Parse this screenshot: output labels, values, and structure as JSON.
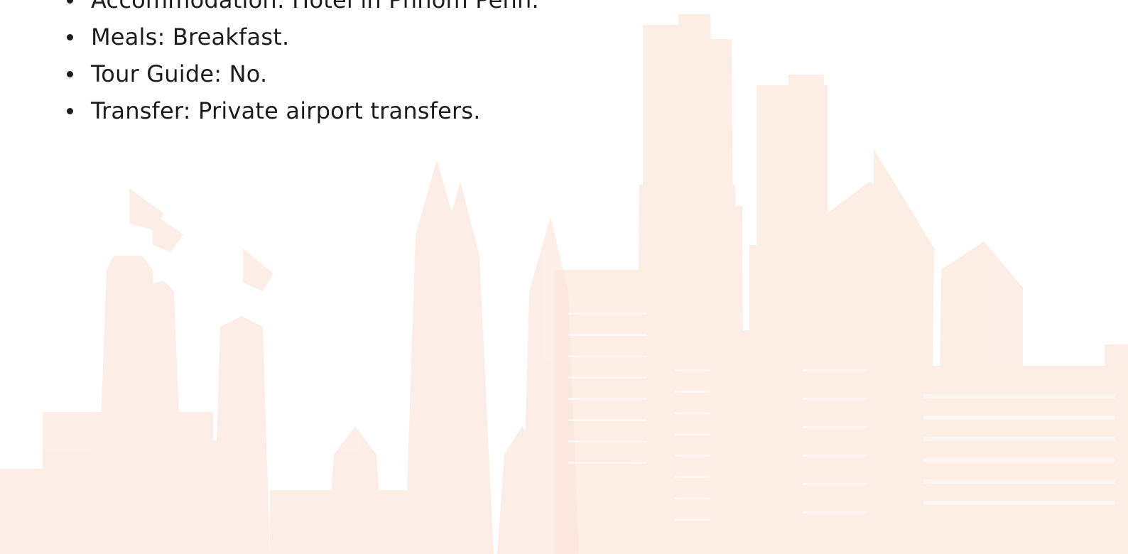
{
  "tour_details": {
    "items": [
      {
        "label": "Accommodation: Hotel in Phnom Penh."
      },
      {
        "label": "Meals: Breakfast."
      },
      {
        "label": "Tour Guide: No."
      },
      {
        "label": "Transfer: Private airport transfers."
      }
    ]
  },
  "background": {
    "illustration": "city-skyline-watermark",
    "tint_light": "#fdf0ea",
    "tint_mid": "#fbe6dc"
  }
}
